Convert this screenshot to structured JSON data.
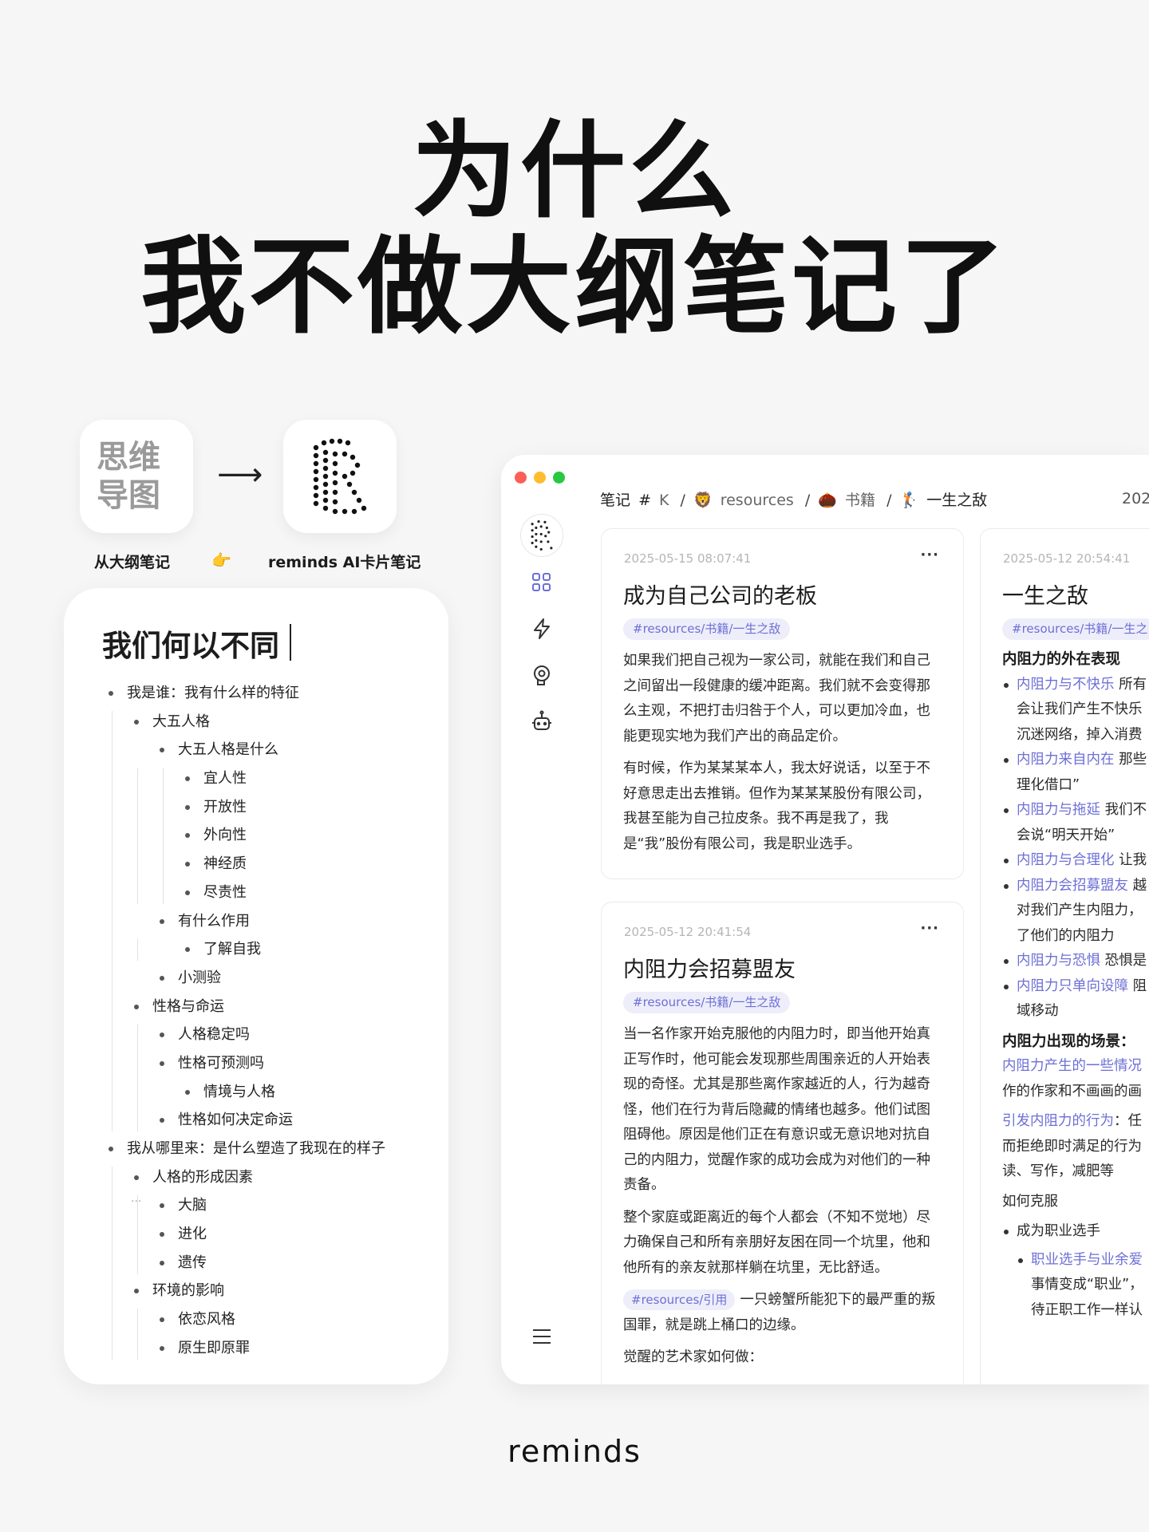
{
  "headline": {
    "line1": "为什么",
    "line2": "我不做大纲笔记了"
  },
  "compare": {
    "from_icon_text": [
      "思维",
      "导图"
    ],
    "arrow": "⟶",
    "from_caption": "从大纲笔记",
    "hand": "👉",
    "to_caption": "reminds AI卡片笔记"
  },
  "outline": {
    "title": "我们何以不同",
    "items": [
      {
        "level": 0,
        "text": "我是谁：我有什么样的特征"
      },
      {
        "level": 1,
        "text": "大五人格"
      },
      {
        "level": 2,
        "text": "大五人格是什么"
      },
      {
        "level": 3,
        "text": "宜人性"
      },
      {
        "level": 3,
        "text": "开放性"
      },
      {
        "level": 3,
        "text": "外向性"
      },
      {
        "level": 3,
        "text": "神经质"
      },
      {
        "level": 3,
        "text": "尽责性"
      },
      {
        "level": 2,
        "text": "有什么作用"
      },
      {
        "level": 3,
        "text": "了解自我"
      },
      {
        "level": 2,
        "text": "小测验"
      },
      {
        "level": 1,
        "text": "性格与命运"
      },
      {
        "level": 2,
        "text": "人格稳定吗"
      },
      {
        "level": 2,
        "text": "性格可预测吗"
      },
      {
        "level": 3,
        "text": "情境与人格"
      },
      {
        "level": 2,
        "text": "性格如何决定命运"
      },
      {
        "level": 0,
        "text": "我从哪里来：是什么塑造了我现在的样子"
      },
      {
        "level": 1,
        "text": "人格的形成因素"
      },
      {
        "level": 2,
        "text": "大脑"
      },
      {
        "level": 2,
        "text": "进化"
      },
      {
        "level": 2,
        "text": "遗传"
      },
      {
        "level": 1,
        "text": "环境的影响"
      },
      {
        "level": 2,
        "text": "依恋风格"
      },
      {
        "level": 2,
        "text": "原生即原罪"
      }
    ],
    "more_dots": "···"
  },
  "app": {
    "breadcrumb": {
      "root": "笔记",
      "hash": "#",
      "k": "K",
      "resources": "resources",
      "books": "书籍",
      "current": "一生之敌",
      "year_partial": "202",
      "icon_resources": "🦁",
      "icon_books": "🌰",
      "icon_current": "🏌"
    },
    "rail_icons": [
      "grid-icon",
      "bolt-icon",
      "brain-icon",
      "robot-icon",
      "menu-icon"
    ],
    "cards": [
      {
        "time": "2025-05-15 08:07:41",
        "more": "···",
        "title": "成为自己公司的老板",
        "tag": "#resources/书籍/一生之敌",
        "paragraphs": [
          "如果我们把自己视为一家公司，就能在我们和自己之间留出一段健康的缓冲距离。我们就不会变得那么主观，不把打击归咎于个人，可以更加冷血，也能更现实地为我们产出的商品定价。",
          "有时候，作为某某某本人，我太好说话，以至于不好意思走出去推销。但作为某某某股份有限公司，我甚至能为自己拉皮条。我不再是我了，我是“我”股份有限公司，我是职业选手。"
        ]
      },
      {
        "time": "2025-05-12 20:41:54",
        "more": "···",
        "title": "内阻力会招募盟友",
        "tag": "#resources/书籍/一生之敌",
        "paragraphs": [
          "当一名作家开始克服他的内阻力时，即当他开始真正写作时，他可能会发现那些周围亲近的人开始表现的奇怪。尤其是那些离作家越近的人，行为越奇怪，他们在行为背后隐藏的情绪也越多。他们试图阻碍他。原因是他们正在有意识或无意识地对抗自己的内阻力，觉醒作家的成功会成为对他们的一种责备。",
          "整个家庭或距离近的每个人都会（不知不觉地）尽力确保自己和所有亲朋好友困在同一个坑里，他和他所有的亲友就那样躺在坑里，无比舒适。"
        ],
        "inline_tag": "#resources/引用",
        "inline_text": "一只螃蟹所能犯下的最严重的叛国罪，就是跳上桶口的边缘。",
        "last_line": "觉醒的艺术家如何做："
      },
      {
        "time": "2025-05-12 20:54:41",
        "title": "一生之敌",
        "tag": "#resources/书籍/一生之",
        "heading1": "内阻力的外在表现",
        "bullets": [
          {
            "link": "内阻力与不快乐",
            "text": " 所有",
            "cont": [
              "会让我们产生不快乐",
              "沉迷网络，掉入消费"
            ]
          },
          {
            "link": "内阻力来自内在",
            "text": " 那些",
            "cont": [
              "理化借口”"
            ]
          },
          {
            "link": "内阻力与拖延",
            "text": " 我们不",
            "cont": [
              "会说“明天开始”"
            ]
          },
          {
            "link": "内阻力与合理化",
            "text": " 让我",
            "cont": []
          },
          {
            "link": "内阻力会招募盟友",
            "text": " 越",
            "cont": [
              "对我们产生内阻力，",
              "了他们的内阻力"
            ]
          },
          {
            "link": "内阻力与恐惧",
            "text": " 恐惧是",
            "cont": []
          },
          {
            "link": "内阻力只单向设障",
            "text": " 阻",
            "cont": [
              "域移动"
            ]
          }
        ],
        "heading2": "内阻力出现的场景：",
        "scene_link": "内阻力产生的一些情况",
        "scene_line2": "作的作家和不画画的画",
        "trigger_link": "引发内阻力的行为",
        "trigger_text": "：任",
        "trigger_line2": "而拒绝即时满足的行为",
        "trigger_line3": "读、写作，减肥等",
        "how": "如何克服",
        "pro": "成为职业选手",
        "sub_link": "职业选手与业余爱",
        "sub_line2": "事情变成“职业”，",
        "sub_line3": "待正职工作一样认"
      }
    ]
  },
  "brand": "reminds"
}
